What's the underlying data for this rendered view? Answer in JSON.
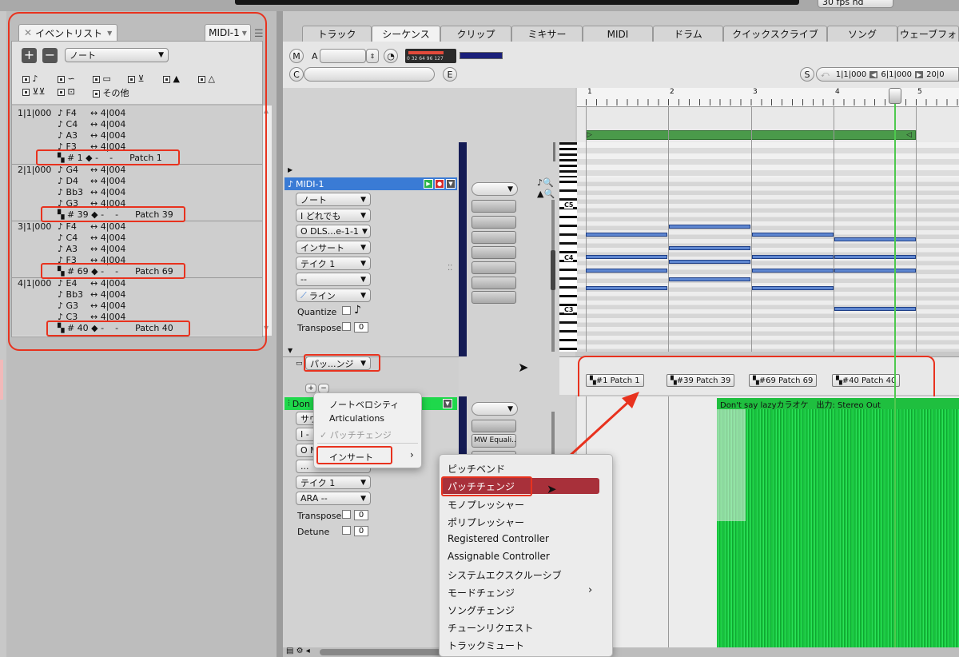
{
  "top": {
    "fps": "30 fps nd"
  },
  "event_list": {
    "tab": "イベントリスト",
    "midi_tab": "MIDI-1",
    "filter": "ノート",
    "icons_row1": [
      "note-icon",
      "wave-icon",
      "rect-icon",
      "pedal-icon",
      "mountain-icon",
      "mountain-outline-icon"
    ],
    "icons_row2": [
      "double-pedal-icon",
      "square-icon",
      "その他"
    ],
    "other_label": "その他",
    "events": [
      {
        "pos": "1|1|000",
        "notes": [
          [
            "F4",
            "4|004"
          ],
          [
            "C4",
            "4|004"
          ],
          [
            "A3",
            "4|004"
          ],
          [
            "F3",
            "4|004"
          ]
        ],
        "patch_num": "# 1",
        "patch_name": "Patch 1"
      },
      {
        "pos": "2|1|000",
        "notes": [
          [
            "G4",
            "4|004"
          ],
          [
            "D4",
            "4|004"
          ],
          [
            "Bb3",
            "4|004"
          ],
          [
            "G3",
            "4|004"
          ]
        ],
        "patch_num": "# 39",
        "patch_name": "Patch 39"
      },
      {
        "pos": "3|1|000",
        "notes": [
          [
            "F4",
            "4|004"
          ],
          [
            "C4",
            "4|004"
          ],
          [
            "A3",
            "4|004"
          ],
          [
            "F3",
            "4|004"
          ]
        ],
        "patch_num": "# 69",
        "patch_name": "Patch 69"
      },
      {
        "pos": "4|1|000",
        "notes": [
          [
            "E4",
            "4|004"
          ],
          [
            "Bb3",
            "4|004"
          ],
          [
            "G3",
            "4|004"
          ],
          [
            "C3",
            "4|004"
          ]
        ],
        "patch_num": "# 40",
        "patch_name": "Patch 40"
      }
    ],
    "dash": "-"
  },
  "tabs": [
    "トラック",
    "シーケンス",
    "クリップ",
    "ミキサー",
    "MIDI",
    "ドラム",
    "クイックスクライブ",
    "ソング",
    "ウェーブフォ"
  ],
  "toolbar": {
    "m": "M",
    "a": "A",
    "c": "C",
    "e": "E",
    "s": "S",
    "meter": "0 32 64 96 127",
    "loc1": "1|1|000",
    "loc2": "6|1|000",
    "loc3": "20|0"
  },
  "track1": {
    "name": "MIDI-1",
    "fields": [
      "ノート",
      "I どれでも",
      "O DLS...e-1-1",
      "インサート",
      "テイク 1",
      "--",
      "ライン"
    ],
    "quantize": "Quantize",
    "transpose": "Transpose",
    "transpose_val": "0",
    "lane": "パッ...ンジ"
  },
  "track2": {
    "name": "Don",
    "fields": [
      "サウ",
      "I -",
      "O M",
      "...",
      "テイク 1",
      "ARA --"
    ],
    "transpose": "Transpose",
    "transpose_val": "0",
    "detune": "Detune",
    "detune_val": "0",
    "plugin": "MW Equali..."
  },
  "ruler": [
    "1",
    "2",
    "3",
    "4",
    "5"
  ],
  "keys": [
    "C5",
    "C4",
    "C3"
  ],
  "patches": [
    {
      "num": "#1",
      "name": "Patch 1"
    },
    {
      "num": "#39",
      "name": "Patch 39"
    },
    {
      "num": "#69",
      "name": "Patch 69"
    },
    {
      "num": "#40",
      "name": "Patch 40"
    }
  ],
  "audio_title": "Don't say lazyカラオケ　出力: Stereo Out",
  "menu1": {
    "items": [
      "ノートベロシティ",
      "Articulations",
      "パッチチェンジ"
    ],
    "insert": "インサート"
  },
  "menu2": {
    "items": [
      "ピッチベンド",
      "パッチチェンジ",
      "モノプレッシャー",
      "ポリプレッシャー",
      "Registered Controller",
      "Assignable Controller",
      "システムエクスクルーシブ",
      "モードチェンジ",
      "ソングチェンジ",
      "チューンリクエスト",
      "トラックミュート"
    ]
  },
  "colors": {
    "accent": "#e8321e",
    "selected": "#a8303a",
    "midi_track": "#3a7bd5",
    "audio": "#1fd84b"
  }
}
